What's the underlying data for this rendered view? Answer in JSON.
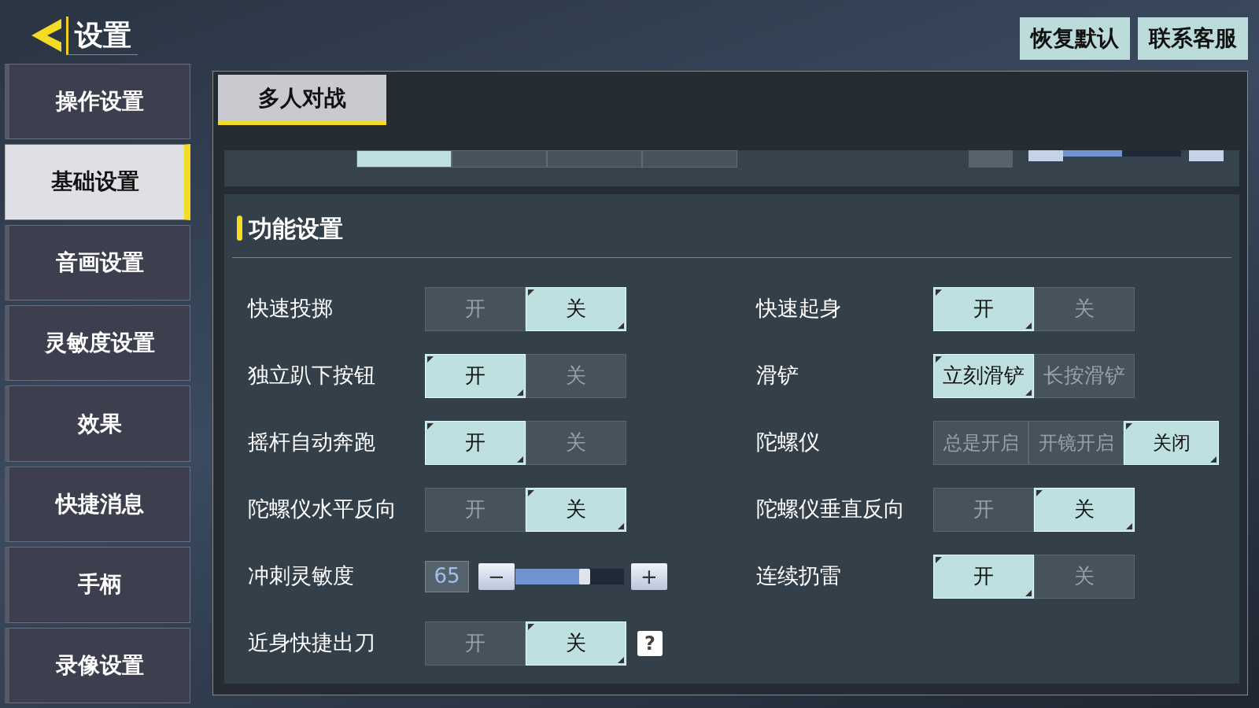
{
  "header": {
    "title": "设置"
  },
  "top_buttons": [
    "恢复默认",
    "联系客服"
  ],
  "sidebar": {
    "items": [
      {
        "label": "操作设置",
        "selected": false
      },
      {
        "label": "基础设置",
        "selected": true
      },
      {
        "label": "音画设置",
        "selected": false
      },
      {
        "label": "灵敏度设置",
        "selected": false
      },
      {
        "label": "效果",
        "selected": false
      },
      {
        "label": "快捷消息",
        "selected": false
      },
      {
        "label": "手柄",
        "selected": false
      },
      {
        "label": "录像设置",
        "selected": false
      }
    ]
  },
  "tabs": [
    {
      "label": "多人对战",
      "selected": true
    }
  ],
  "hidden_row": {
    "options": [
      {
        "selected": true
      },
      {
        "selected": false
      },
      {
        "selected": false
      },
      {
        "selected": false
      }
    ],
    "slider": {
      "level": 0.5
    }
  },
  "section": {
    "title": "功能设置",
    "rows": [
      {
        "left": {
          "kind": "toggle",
          "label": "快速投掷",
          "options": [
            {
              "label": "开",
              "selected": false
            },
            {
              "label": "关",
              "selected": true
            }
          ]
        },
        "right": {
          "kind": "toggle",
          "label": "快速起身",
          "options": [
            {
              "label": "开",
              "selected": true
            },
            {
              "label": "关",
              "selected": false
            }
          ]
        }
      },
      {
        "left": {
          "kind": "toggle",
          "label": "独立趴下按钮",
          "options": [
            {
              "label": "开",
              "selected": true
            },
            {
              "label": "关",
              "selected": false
            }
          ]
        },
        "right": {
          "kind": "toggle",
          "label": "滑铲",
          "options": [
            {
              "label": "立刻滑铲",
              "selected": true
            },
            {
              "label": "长按滑铲",
              "selected": false
            }
          ]
        }
      },
      {
        "left": {
          "kind": "toggle",
          "label": "摇杆自动奔跑",
          "options": [
            {
              "label": "开",
              "selected": true
            },
            {
              "label": "关",
              "selected": false
            }
          ]
        },
        "right": {
          "kind": "toggle",
          "label": "陀螺仪",
          "options": [
            {
              "label": "总是开启",
              "selected": false
            },
            {
              "label": "开镜开启",
              "selected": false
            },
            {
              "label": "关闭",
              "selected": true
            }
          ]
        }
      },
      {
        "left": {
          "kind": "toggle",
          "label": "陀螺仪水平反向",
          "options": [
            {
              "label": "开",
              "selected": false
            },
            {
              "label": "关",
              "selected": true
            }
          ]
        },
        "right": {
          "kind": "toggle",
          "label": "陀螺仪垂直反向",
          "options": [
            {
              "label": "开",
              "selected": false
            },
            {
              "label": "关",
              "selected": true
            }
          ]
        }
      },
      {
        "left": {
          "kind": "slider",
          "label": "冲刺灵敏度",
          "value": "65",
          "minus": "−",
          "plus": "+",
          "level": 0.64
        },
        "right": {
          "kind": "toggle",
          "label": "连续扔雷",
          "options": [
            {
              "label": "开",
              "selected": true
            },
            {
              "label": "关",
              "selected": false
            }
          ]
        }
      },
      {
        "left": {
          "kind": "toggle",
          "label": "近身快捷出刀",
          "help": "?",
          "options": [
            {
              "label": "开",
              "selected": false
            },
            {
              "label": "关",
              "selected": true
            }
          ]
        }
      }
    ]
  }
}
